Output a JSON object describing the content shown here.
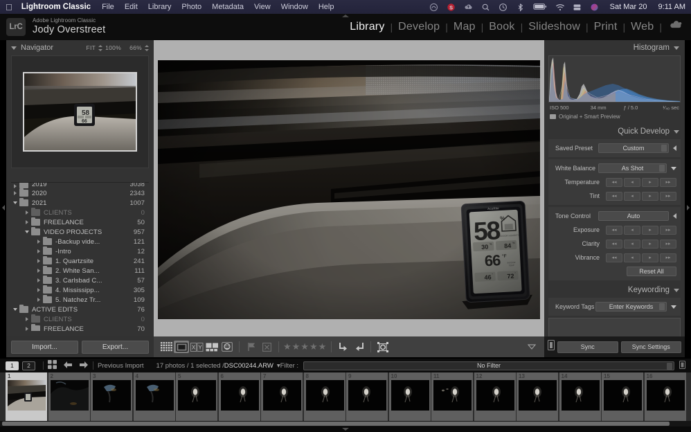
{
  "menubar": {
    "apple": "",
    "app_name": "Lightroom Classic",
    "items": [
      "File",
      "Edit",
      "Library",
      "Photo",
      "Metadata",
      "View",
      "Window",
      "Help"
    ],
    "tray_icons": [
      "creative-cloud-icon",
      "spotify-icon",
      "upload-cloud-icon",
      "search-icon",
      "clock-icon",
      "bluetooth-icon",
      "battery-icon",
      "wifi-icon",
      "display-icon",
      "siri-icon"
    ],
    "date": "Sat Mar 20",
    "time": "9:11 AM"
  },
  "identity": {
    "badge": "LrC",
    "subtitle": "Adobe Lightroom Classic",
    "name": "Jody Overstreet"
  },
  "modules": {
    "items": [
      "Library",
      "Develop",
      "Map",
      "Book",
      "Slideshow",
      "Print",
      "Web"
    ],
    "active": "Library",
    "cloud_icon": "cloud-sync-icon"
  },
  "navigator": {
    "title": "Navigator",
    "zoom_options": [
      "FIT",
      "100%",
      "66%"
    ],
    "collapse_icon": "triangle-down-icon"
  },
  "folders": [
    {
      "name": "2019",
      "count": "3038",
      "depth": 0,
      "twisty": "right",
      "dim": false,
      "clipped": true
    },
    {
      "name": "2020",
      "count": "2343",
      "depth": 0,
      "twisty": "right",
      "dim": false
    },
    {
      "name": "2021",
      "count": "1007",
      "depth": 0,
      "twisty": "down",
      "dim": false
    },
    {
      "name": "CLIENTS",
      "count": "0",
      "depth": 1,
      "twisty": "right",
      "dim": true
    },
    {
      "name": "FREELANCE",
      "count": "50",
      "depth": 1,
      "twisty": "right",
      "dim": false
    },
    {
      "name": "VIDEO PROJECTS",
      "count": "957",
      "depth": 1,
      "twisty": "down",
      "dim": false
    },
    {
      "name": "-Backup vide...",
      "count": "121",
      "depth": 2,
      "twisty": "right",
      "dim": false
    },
    {
      "name": "-Intro",
      "count": "12",
      "depth": 2,
      "twisty": "right",
      "dim": false
    },
    {
      "name": "1. Quartzsite",
      "count": "241",
      "depth": 2,
      "twisty": "right",
      "dim": false
    },
    {
      "name": "2. White San...",
      "count": "111",
      "depth": 2,
      "twisty": "right",
      "dim": false
    },
    {
      "name": "3. Carlsbad C...",
      "count": "57",
      "depth": 2,
      "twisty": "right",
      "dim": false
    },
    {
      "name": "4. Mississipp...",
      "count": "305",
      "depth": 2,
      "twisty": "right",
      "dim": false
    },
    {
      "name": "5. Natchez Tr...",
      "count": "109",
      "depth": 2,
      "twisty": "right",
      "dim": false
    },
    {
      "name": "ACTIVE EDITS",
      "count": "76",
      "depth": 0,
      "twisty": "down",
      "dim": false
    },
    {
      "name": "CLIENTS",
      "count": "0",
      "depth": 1,
      "twisty": "right",
      "dim": true
    },
    {
      "name": "FREELANCE",
      "count": "70",
      "depth": 1,
      "twisty": "right",
      "dim": false
    }
  ],
  "histogram": {
    "title": "Histogram",
    "iso": "ISO 500",
    "focal": "34 mm",
    "aperture": "ƒ / 5.0",
    "shutter": "¹⁄₄₀ sec",
    "preview_status": "Original + Smart Preview"
  },
  "quick_develop": {
    "title": "Quick Develop",
    "saved_preset_label": "Saved Preset",
    "saved_preset_value": "Custom",
    "white_balance_label": "White Balance",
    "white_balance_value": "As Shot",
    "temperature_label": "Temperature",
    "tint_label": "Tint",
    "tone_control_label": "Tone Control",
    "auto_label": "Auto",
    "exposure_label": "Exposure",
    "clarity_label": "Clarity",
    "vibrance_label": "Vibrance",
    "reset_label": "Reset All"
  },
  "keywording": {
    "title": "Keywording",
    "tags_label": "Keyword Tags",
    "tags_placeholder": "Enter Keywords"
  },
  "toolbar": {
    "import_label": "Import...",
    "export_label": "Export...",
    "view_icons": [
      "grid-view-icon",
      "loupe-view-icon",
      "compare-view-icon",
      "survey-view-icon",
      "people-view-icon"
    ],
    "active_view": "loupe-view-icon",
    "flag_icon": "flag-icon",
    "reject_icon": "reject-flag-icon",
    "stars": "★★★★★",
    "rotate_right_icon": "rotate-right-icon",
    "rotate_left_icon": "rotate-left-icon",
    "crop_icon": "crop-overlay-icon",
    "dropdown_icon": "triangle-down-icon",
    "sync_label": "Sync",
    "sync_settings_label": "Sync Settings"
  },
  "filmstrip_header": {
    "screen1": "1",
    "screen2": "2",
    "grid_icon": "grid-icon",
    "back_icon": "arrow-left-icon",
    "forward_icon": "arrow-right-icon",
    "source": "Previous Import",
    "status": "17 photos / 1 selected / ",
    "filename": "DSC00244.ARW",
    "filter_label": "Filter :",
    "filter_value": "No Filter"
  },
  "filmstrip": {
    "thumbs": [
      {
        "num": "1",
        "selected": true,
        "kind": "window"
      },
      {
        "num": "2",
        "selected": false,
        "kind": "dark-cave"
      },
      {
        "num": "3",
        "selected": false,
        "kind": "dark-blue"
      },
      {
        "num": "4",
        "selected": false,
        "kind": "dark-blue"
      },
      {
        "num": "5",
        "selected": false,
        "kind": "dark-light"
      },
      {
        "num": "6",
        "selected": false,
        "kind": "dark-light"
      },
      {
        "num": "7",
        "selected": false,
        "kind": "dark-light"
      },
      {
        "num": "8",
        "selected": false,
        "kind": "dark-light"
      },
      {
        "num": "9",
        "selected": false,
        "kind": "dark-light"
      },
      {
        "num": "10",
        "selected": false,
        "kind": "dark-light"
      },
      {
        "num": "11",
        "selected": false,
        "kind": "dark-light"
      },
      {
        "num": "12",
        "selected": false,
        "kind": "dark-light"
      },
      {
        "num": "13",
        "selected": false,
        "kind": "dark-light"
      },
      {
        "num": "14",
        "selected": false,
        "kind": "dark-light"
      },
      {
        "num": "15",
        "selected": false,
        "kind": "dark-light"
      },
      {
        "num": "16",
        "selected": false,
        "kind": "dark-light"
      }
    ]
  },
  "photo": {
    "subject": "AcuRite indoor humidity and temperature monitor on an RV window sill",
    "humidity": "58",
    "humidity_unit": "%",
    "humidity_min": "30",
    "humidity_max": "84",
    "temperature": "66",
    "temperature_unit": "°F",
    "temp_min": "46",
    "temp_max": "72",
    "brand": "AcuRite"
  },
  "colors": {
    "panel_bg": "#333333",
    "work_bg": "#b0b0b0",
    "accent_text": "#f2f2f2",
    "menubar_bg": "#25253c"
  }
}
